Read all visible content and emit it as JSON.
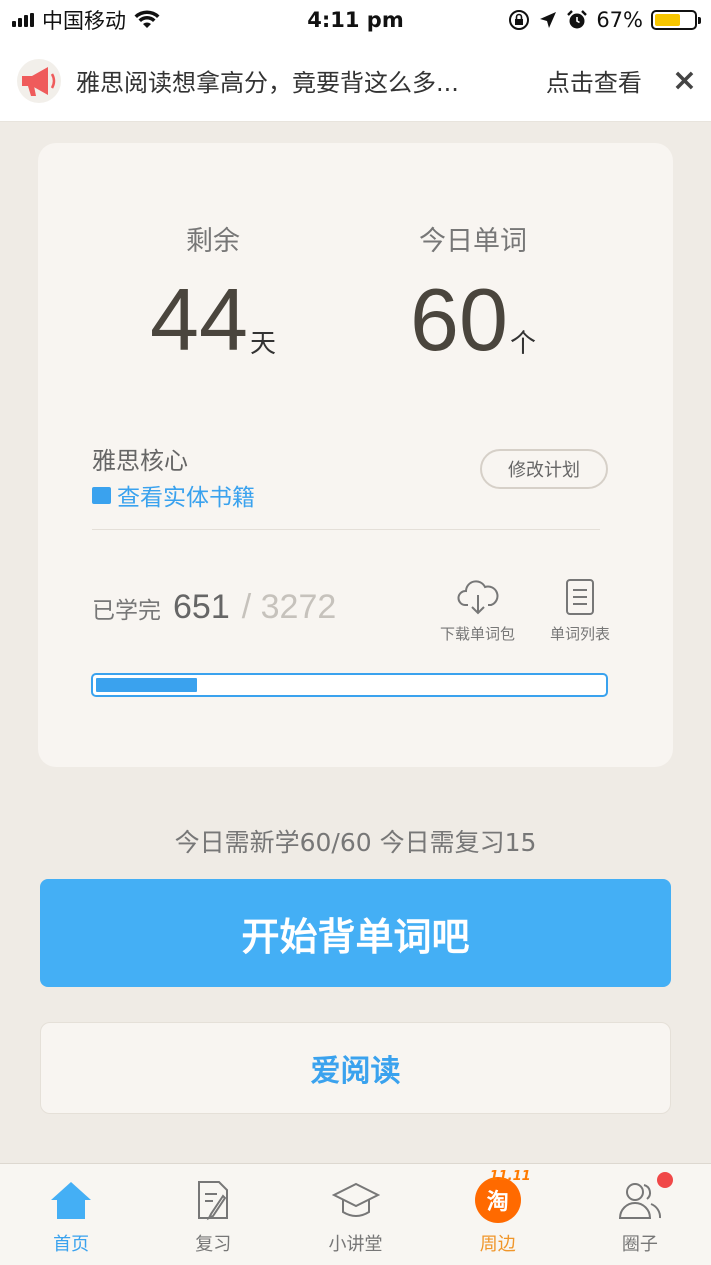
{
  "status_bar": {
    "carrier": "中国移动",
    "time": "4:11 pm",
    "battery_percent": "67%",
    "battery_level": 0.67
  },
  "banner": {
    "text": "雅思阅读想拿高分，竟要背这么多...",
    "link": "点击查看",
    "close": "×"
  },
  "plan": {
    "remaining_label": "剩余",
    "remaining_value": "44",
    "remaining_unit": "天",
    "today_words_label": "今日单词",
    "today_words_value": "60",
    "today_words_unit": "个",
    "book_name": "雅思核心",
    "book_link": "查看实体书籍",
    "edit_button": "修改计划"
  },
  "progress": {
    "label": "已学完",
    "done": "651",
    "total": "/ 3272",
    "fraction": 0.199
  },
  "tools": {
    "download": "下载单词包",
    "list": "单词列表"
  },
  "summary": "今日需新学60/60  今日需复习15",
  "buttons": {
    "start": "开始背单词吧",
    "read": "爱阅读"
  },
  "tabs": [
    {
      "label": "首页",
      "icon": "home-icon"
    },
    {
      "label": "复习",
      "icon": "review-icon"
    },
    {
      "label": "小讲堂",
      "icon": "graduation-cap-icon"
    },
    {
      "label": "周边",
      "icon": "taobao-icon",
      "badge_text": "淘",
      "tag": "11.11"
    },
    {
      "label": "圈子",
      "icon": "people-icon"
    }
  ],
  "colors": {
    "accent": "#44aff5",
    "background": "#efebe5",
    "card": "#f8f5f1",
    "badge": "#f04848"
  }
}
